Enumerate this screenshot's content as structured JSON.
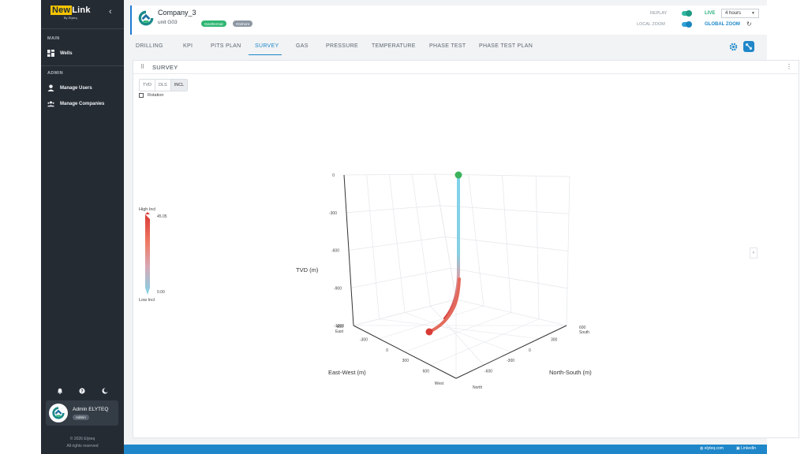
{
  "brand": {
    "name_part1": "New",
    "name_part2": "Link",
    "tagline": "By Elyteq"
  },
  "sidebar": {
    "sections": [
      {
        "title": "MAIN",
        "items": [
          {
            "label": "Wells",
            "icon": "dashboard-icon"
          }
        ]
      },
      {
        "title": "ADMIN",
        "items": [
          {
            "label": "Manage Users",
            "icon": "user-icon"
          },
          {
            "label": "Manage Companies",
            "icon": "users-group-icon"
          }
        ]
      }
    ],
    "user": {
      "name": "Admin ELYTEQ",
      "role": "Admin"
    },
    "copyright_line1": "© 2026 Elyteq",
    "copyright_line2": "All rights reserved"
  },
  "header": {
    "company": "Company_3",
    "unit": "unit G03",
    "tags": [
      "Geothermal",
      "Onshore"
    ],
    "replay_label": "REPLAY",
    "live_label": "LIVE",
    "local_zoom_label": "LOCAL ZOOM",
    "global_zoom_label": "GLOBAL ZOOM",
    "time_range": "4 hours"
  },
  "tabs": [
    "DRILLING",
    "KPI",
    "PITS PLAN",
    "SURVEY",
    "GAS",
    "PRESSURE",
    "TEMPERATURE",
    "PHASE TEST",
    "PHASE TEST PLAN"
  ],
  "active_tab": "SURVEY",
  "panel": {
    "title": "SURVEY",
    "modes": [
      "TVD",
      "DLS",
      "INCL"
    ],
    "active_mode": "INCL",
    "rotation_label": "Rotation",
    "rotation_checked": false
  },
  "colors": {
    "accent": "#1f87c9",
    "sidebar": "#252b33",
    "live": "#28b07a",
    "high_incl": "#d93a35",
    "low_incl": "#7fd3ea"
  },
  "chart_data": {
    "type": "line3d",
    "colorbar": {
      "top_label": "High Incl",
      "bottom_label": "Low Incl",
      "max": "45.05",
      "min": "0.00"
    },
    "tvd_axis": {
      "label": "TVD (m)",
      "ticks": [
        "0",
        "-300",
        "-600",
        "-900",
        "-1200"
      ]
    },
    "ew_axis": {
      "label": "East-West (m)",
      "ticks": [
        "-300",
        "0",
        "300",
        "600"
      ],
      "end_labels": [
        "-600",
        "East",
        "West"
      ]
    },
    "ns_axis": {
      "label": "North-South (m)",
      "ticks": [
        "300",
        "0",
        "-300",
        "-600"
      ],
      "end_labels": [
        "600",
        "South",
        "North"
      ]
    },
    "well_path": {
      "start_marker": "surface",
      "end_marker": "bottom",
      "tvd_range": [
        0,
        -1200
      ]
    }
  },
  "footer": {
    "links": [
      "elyteq.com",
      "LinkedIn"
    ]
  }
}
